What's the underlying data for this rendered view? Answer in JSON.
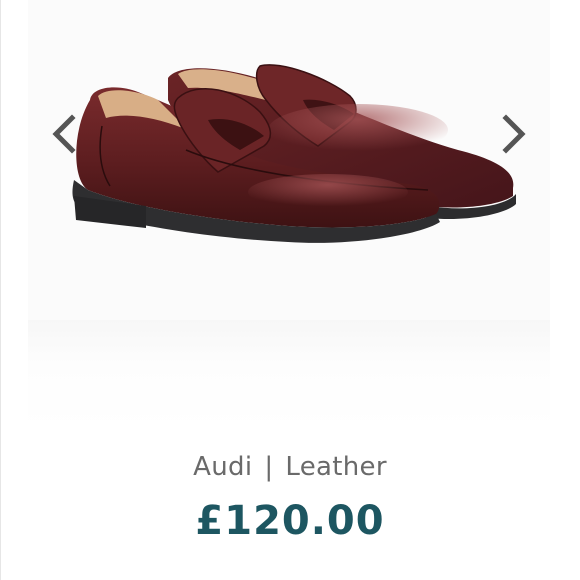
{
  "product": {
    "name": "Audi",
    "separator": "|",
    "material": "Leather",
    "price": "£120.00"
  },
  "gallery": {
    "prev_icon": "chevron-left-icon",
    "next_icon": "chevron-right-icon"
  },
  "colors": {
    "price": "#1d5661",
    "name": "#6a6a6a",
    "arrow": "#555555",
    "shoe_leather": "#5a1a1c"
  }
}
